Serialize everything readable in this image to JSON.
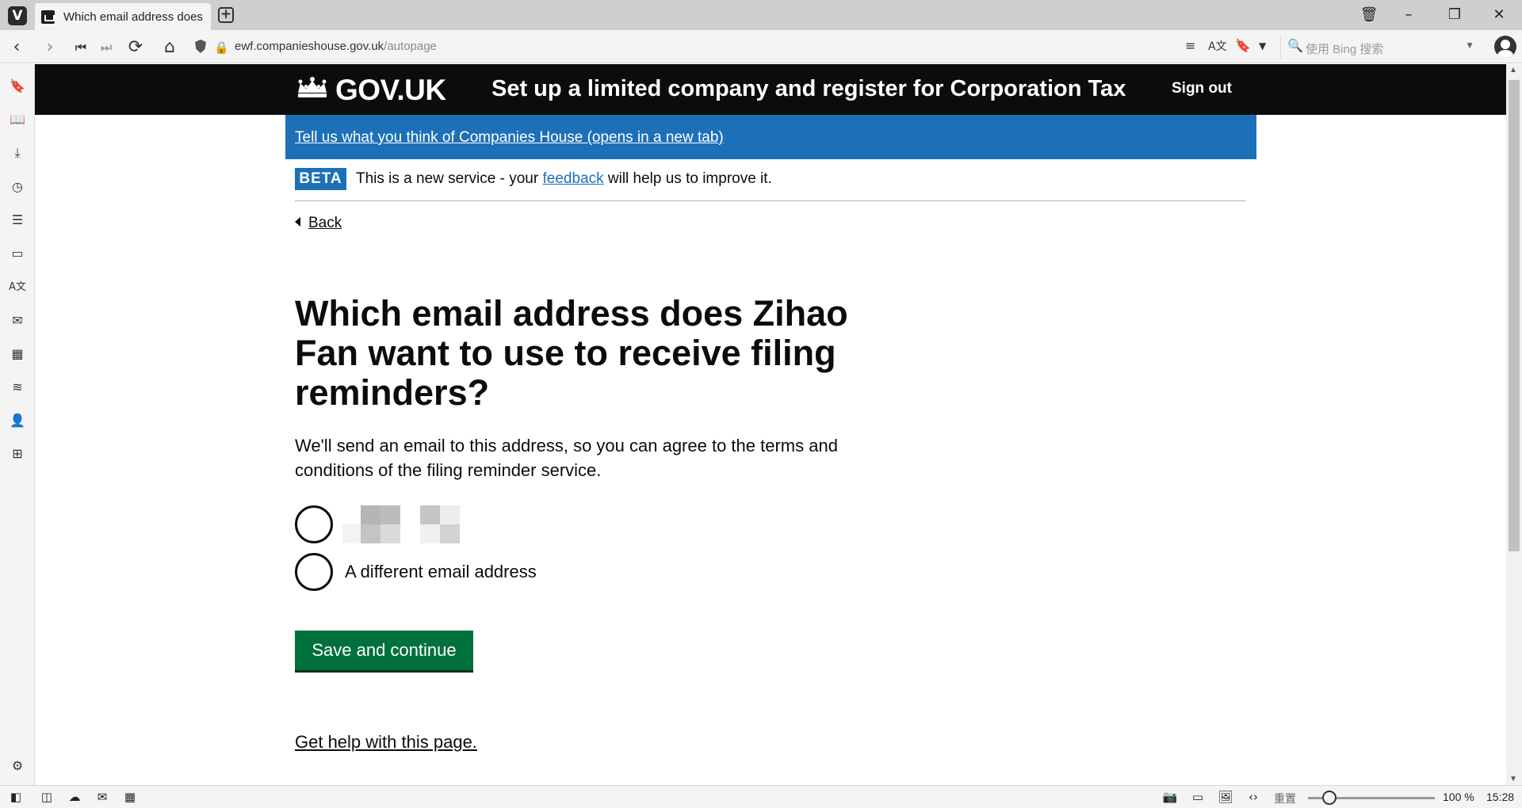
{
  "browser": {
    "tab_title": "Which email address does Zihao Fan want to use",
    "new_tab_label": "+",
    "url_host": "ewf.companieshouse.gov.uk",
    "url_path": "/autopage",
    "search_placeholder": "使用 Bing 搜索",
    "zoom_label": "重置",
    "zoom_level": "100 %",
    "clock": "15:28"
  },
  "header": {
    "logo_text": "GOV.UK",
    "service_name": "Set up a limited company and register for Corporation Tax",
    "sign_out_label": "Sign out"
  },
  "feedback_banner": {
    "link_text": "Tell us what you think of Companies House (opens in a new tab)"
  },
  "phase_banner": {
    "tag": "BETA",
    "text_before": "This is a new service - your ",
    "link_text": "feedback",
    "text_after": " will help us to improve it."
  },
  "back_link": "Back",
  "question": {
    "title": "Which email address does Zihao Fan want to use to receive filing reminders?",
    "hint": "We'll send an email to this address, so you can agree to the terms and conditions of the filing reminder service.",
    "options": [
      {
        "label": "",
        "redacted": true,
        "selected": false
      },
      {
        "label": "A different email address",
        "redacted": false,
        "selected": false
      }
    ]
  },
  "save_button_label": "Save and continue",
  "help_link": "Get help with this page.",
  "colors": {
    "govuk_black": "#0b0c0c",
    "govuk_blue": "#1d70b8",
    "govuk_green": "#00703c",
    "browser_chrome": "#f4f4f4"
  }
}
